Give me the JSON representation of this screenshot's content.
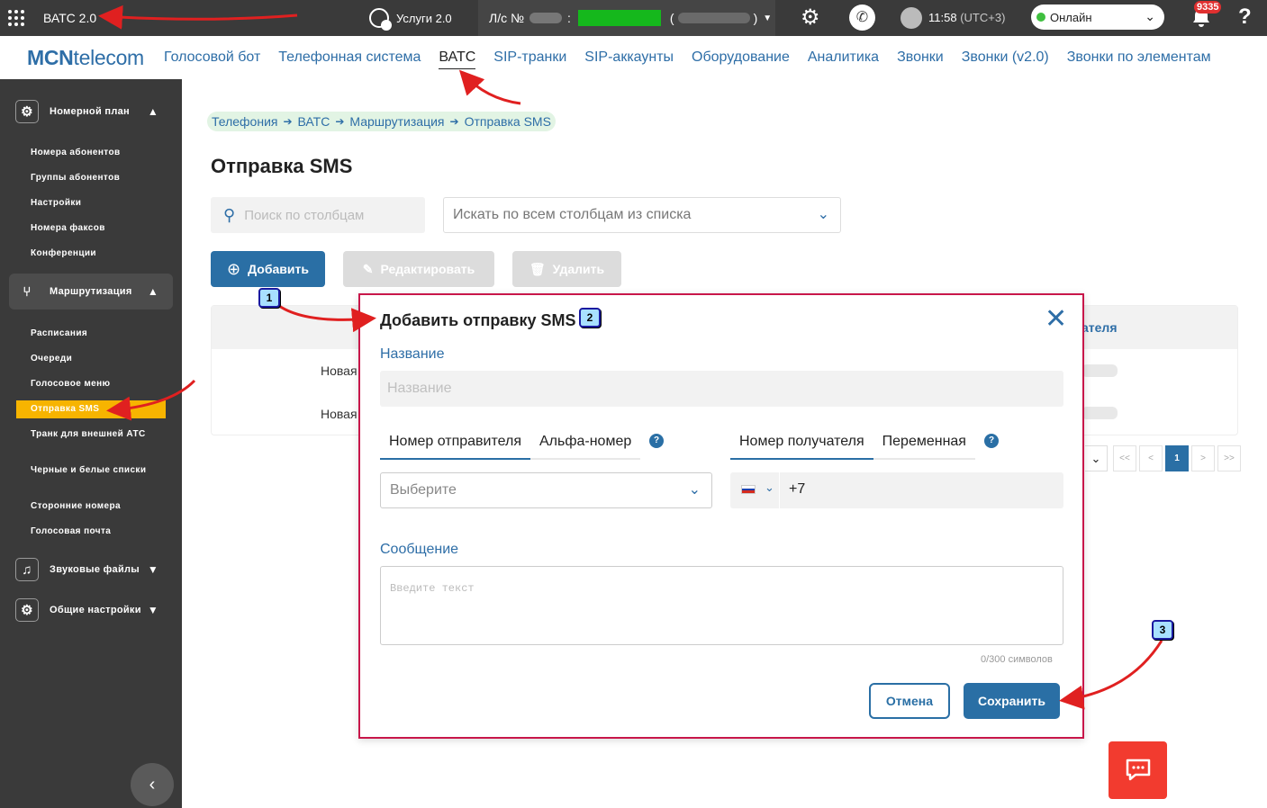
{
  "topbar": {
    "app_title": "ВАТС 2.0",
    "services_label": "Услуги 2.0",
    "account_prefix": "Л/с №",
    "account_colon": ":",
    "account_paren_open": "(",
    "account_paren_close": ")",
    "time": "11:58",
    "timezone": "(UTC+3)",
    "status": "Онлайн",
    "notifications_count": "9335",
    "help": "?"
  },
  "nav": {
    "logo_bold": "MCN",
    "logo_light": "telecom",
    "items": [
      "Голосовой бот",
      "Телефонная система",
      "ВАТС",
      "SIP-транки",
      "SIP-аккаунты",
      "Оборудование",
      "Аналитика",
      "Звонки",
      "Звонки (v2.0)",
      "Звонки по элементам"
    ],
    "active_index": 2
  },
  "sidebar": {
    "section_numplan": "Номерной план",
    "numplan_items": [
      "Номера абонентов",
      "Группы абонентов",
      "Настройки",
      "Номера факсов",
      "Конференции"
    ],
    "section_routing": "Маршрутизация",
    "routing_items": [
      "Расписания",
      "Очереди",
      "Голосовое меню",
      "Отправка SMS",
      "Транк для внешней АТС",
      "Черные и белые списки",
      "Сторонние номера",
      "Голосовая почта"
    ],
    "section_sounds": "Звуковые файлы",
    "section_general": "Общие настройки"
  },
  "main": {
    "breadcrumb": [
      "Телефония",
      "ВАТС",
      "Маршрутизация",
      "Отправка SMS"
    ],
    "title": "Отправка SMS",
    "search_placeholder": "Поиск по столбцам",
    "columns_select": "Искать по всем столбцам из списка",
    "btn_add": "Добавить",
    "btn_edit": "Редактировать",
    "btn_delete": "Удалить",
    "table_header_right": "ателя",
    "rows": [
      "Новая",
      "Новая"
    ],
    "pager": [
      "<<",
      "<",
      "1",
      ">",
      ">>"
    ]
  },
  "modal": {
    "title": "Добавить отправку SMS",
    "name_label": "Название",
    "name_placeholder": "Название",
    "sender_tabs": [
      "Номер отправителя",
      "Альфа-номер"
    ],
    "recipient_tabs": [
      "Номер получателя",
      "Переменная"
    ],
    "help": "?",
    "sender_select_placeholder": "Выберите",
    "phone_prefix": "+7",
    "message_label": "Сообщение",
    "message_placeholder": "Введите текст",
    "counter": "0/300 символов",
    "cancel": "Отмена",
    "save": "Сохранить"
  },
  "annotations": [
    "1",
    "2",
    "3"
  ],
  "colors": {
    "brand": "#2e6ea7",
    "primary_button": "#2a6fa5",
    "sidebar_bg": "#3a3a3a",
    "sidebar_active": "#f7b400",
    "modal_border": "#c8174a",
    "annotation_arrow": "#e02020",
    "chat_button": "#f23b2f"
  }
}
